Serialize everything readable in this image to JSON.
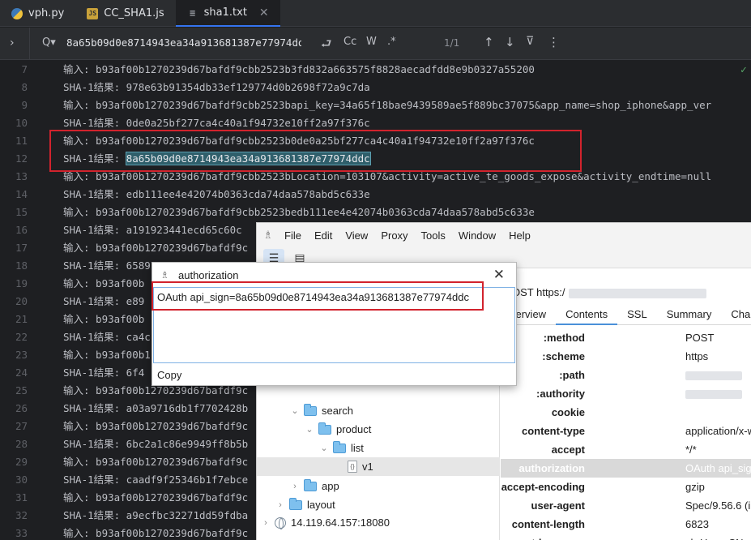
{
  "tabs": [
    {
      "name": "vph.py",
      "icon": "python-file-icon"
    },
    {
      "name": "CC_SHA1.js",
      "icon": "js-file-icon"
    },
    {
      "name": "sha1.txt",
      "icon": "text-file-icon",
      "active": true
    }
  ],
  "find": {
    "query": "8a65b09d0e8714943ea34a913681387e77974ddc",
    "match_case": "Cc",
    "words": "W",
    "regex": ".*",
    "count": "1/1"
  },
  "editor": {
    "lines": [
      {
        "no": "7",
        "text": "输入: b93af00b1270239d67bafdf9cbb2523b3fd832a663575f8828aecadfdd8e9b0327a55200"
      },
      {
        "no": "8",
        "text": "SHA-1结果: 978e63b91354db33ef129774d0b2698f72a9c7da"
      },
      {
        "no": "9",
        "text": "输入: b93af00b1270239d67bafdf9cbb2523bapi_key=34a65f18bae9439589ae5f889bc37075&app_name=shop_iphone&app_ver"
      },
      {
        "no": "10",
        "text": "SHA-1结果: 0de0a25bf277ca4c40a1f94732e10ff2a97f376c"
      },
      {
        "no": "11",
        "text": "输入: b93af00b1270239d67bafdf9cbb2523b0de0a25bf277ca4c40a1f94732e10ff2a97f376c"
      },
      {
        "no": "12",
        "text_prefix": "SHA-1结果: ",
        "match": "8a65b09d0e8714943ea34a913681387e77974ddc"
      },
      {
        "no": "13",
        "text": "输入: b93af00b1270239d67bafdf9cbb2523bLocation=103107&activity=active_te_goods_expose&activity_endtime=null"
      },
      {
        "no": "14",
        "text": "SHA-1结果: edb111ee4e42074b0363cda74daa578abd5c633e"
      },
      {
        "no": "15",
        "text": "输入: b93af00b1270239d67bafdf9cbb2523bedb111ee4e42074b0363cda74daa578abd5c633e"
      },
      {
        "no": "16",
        "text": "SHA-1结果: a191923441ecd65c60c"
      },
      {
        "no": "17",
        "text": "输入: b93af00b1270239d67bafdf9c"
      },
      {
        "no": "18",
        "text": "SHA-1结果: 6589"
      },
      {
        "no": "19",
        "text": "输入: b93af00b"
      },
      {
        "no": "20",
        "text": "SHA-1结果: e89"
      },
      {
        "no": "21",
        "text": "输入: b93af00b"
      },
      {
        "no": "22",
        "text": "SHA-1结果: ca4c"
      },
      {
        "no": "23",
        "text": "输入: b93af00b1"
      },
      {
        "no": "24",
        "text": "SHA-1结果: 6f4"
      },
      {
        "no": "25",
        "text": "输入: b93af00b1270239d67bafdf9c"
      },
      {
        "no": "26",
        "text": "SHA-1结果: a03a9716db1f7702428b"
      },
      {
        "no": "27",
        "text": "输入: b93af00b1270239d67bafdf9c"
      },
      {
        "no": "28",
        "text": "SHA-1结果: 6bc2a1c86e9949ff8b5b"
      },
      {
        "no": "29",
        "text": "输入: b93af00b1270239d67bafdf9c"
      },
      {
        "no": "30",
        "text": "SHA-1结果: caadf9f25346b1f7ebce"
      },
      {
        "no": "31",
        "text": "输入: b93af00b1270239d67bafdf9c"
      },
      {
        "no": "32",
        "text": "SHA-1结果: a9ecfbc32271dd59fdba"
      },
      {
        "no": "33",
        "text": "输入: b93af00b1270239d67bafdf9c"
      }
    ]
  },
  "charles": {
    "menu": [
      "File",
      "Edit",
      "View",
      "Proxy",
      "Tools",
      "Window",
      "Help"
    ],
    "tree": [
      {
        "label": "search",
        "level": 1,
        "type": "folder",
        "expanded": true
      },
      {
        "label": "product",
        "level": 2,
        "type": "folder",
        "expanded": true
      },
      {
        "label": "list",
        "level": 3,
        "type": "folder",
        "expanded": true
      },
      {
        "label": "v1",
        "level": 4,
        "type": "file",
        "selected": true
      },
      {
        "label": "app",
        "level": 1,
        "type": "folder",
        "expanded": false
      },
      {
        "label": "layout",
        "level": 0,
        "type": "folder",
        "expanded": false
      },
      {
        "label": "14.119.64.157:18080",
        "level": -1,
        "type": "host",
        "expanded": false
      }
    ],
    "request_line_method": "OST https:/",
    "detail_tabs": [
      "verview",
      "Contents",
      "SSL",
      "Summary",
      "Char"
    ],
    "detail_active": "Contents",
    "headers": [
      {
        "key": ":method",
        "value": "POST"
      },
      {
        "key": ":scheme",
        "value": "https"
      },
      {
        "key": ":path",
        "value": ""
      },
      {
        "key": ":authority",
        "value": ""
      },
      {
        "key": "cookie",
        "value": ""
      },
      {
        "key": "content-type",
        "value": "application/x-w"
      },
      {
        "key": "accept",
        "value": "*/*"
      },
      {
        "key": "authorization",
        "value": "OAuth api_sign",
        "selected": true
      },
      {
        "key": "accept-encoding",
        "value": "gzip"
      },
      {
        "key": "user-agent",
        "value": "Spec/9.56.6 (iP"
      },
      {
        "key": "content-length",
        "value": "6823"
      },
      {
        "key": "accept-language",
        "value": "zh-Hans-CN;q"
      }
    ]
  },
  "auth_popup": {
    "title": "authorization",
    "value": "OAuth api_sign=8a65b09d0e8714943ea34a913681387e77974ddc",
    "copy_label": "Copy"
  },
  "colors": {
    "highlight_box": "#d2232d",
    "match_bg": "#2f5f6b",
    "editor_bg": "#1e1f22"
  }
}
